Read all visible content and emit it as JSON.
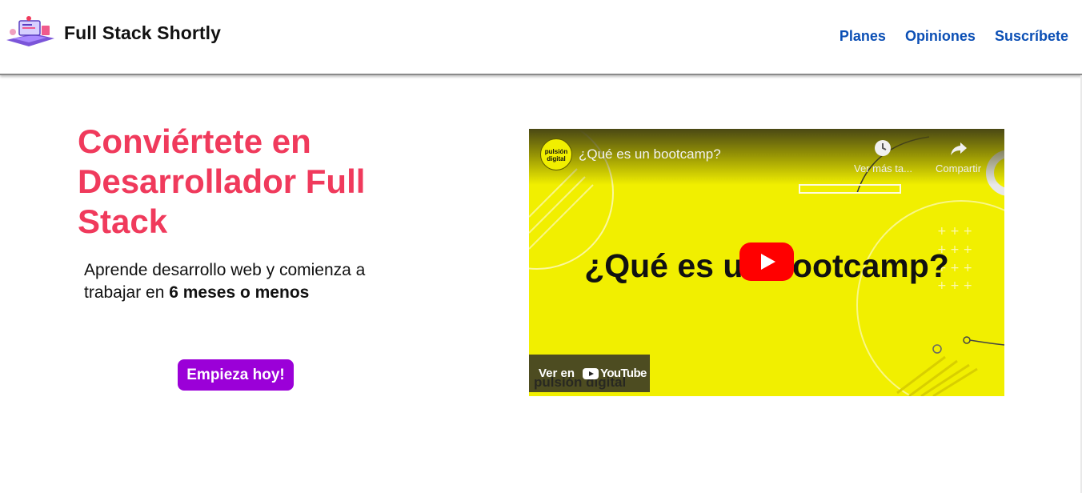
{
  "header": {
    "brand": "Full Stack Shortly",
    "nav": [
      "Planes",
      "Opiniones",
      "Suscríbete"
    ]
  },
  "hero": {
    "title": "Conviértete en Desarrollador Full Stack",
    "subtitle_plain": "Aprende desarrollo web y comienza a trabajar en ",
    "subtitle_bold": "6 meses o menos",
    "cta_label": "Empieza hoy!"
  },
  "video": {
    "title": "¿Qué es un bootcamp?",
    "thumbnail_text": "¿Qué es un bootcamp?",
    "channel": "pulsión digital",
    "watch_later": "Ver más ta...",
    "share": "Compartir",
    "watch_on": "Ver en",
    "platform": "YouTube"
  },
  "colors": {
    "accent_title": "#f03a5c",
    "nav_link": "#0b4fb5",
    "cta_bg": "#9b00d8",
    "video_bg": "#f1ef00"
  },
  "icons": [
    "logo-icon",
    "clock-icon",
    "share-icon",
    "play-icon",
    "youtube-icon"
  ]
}
